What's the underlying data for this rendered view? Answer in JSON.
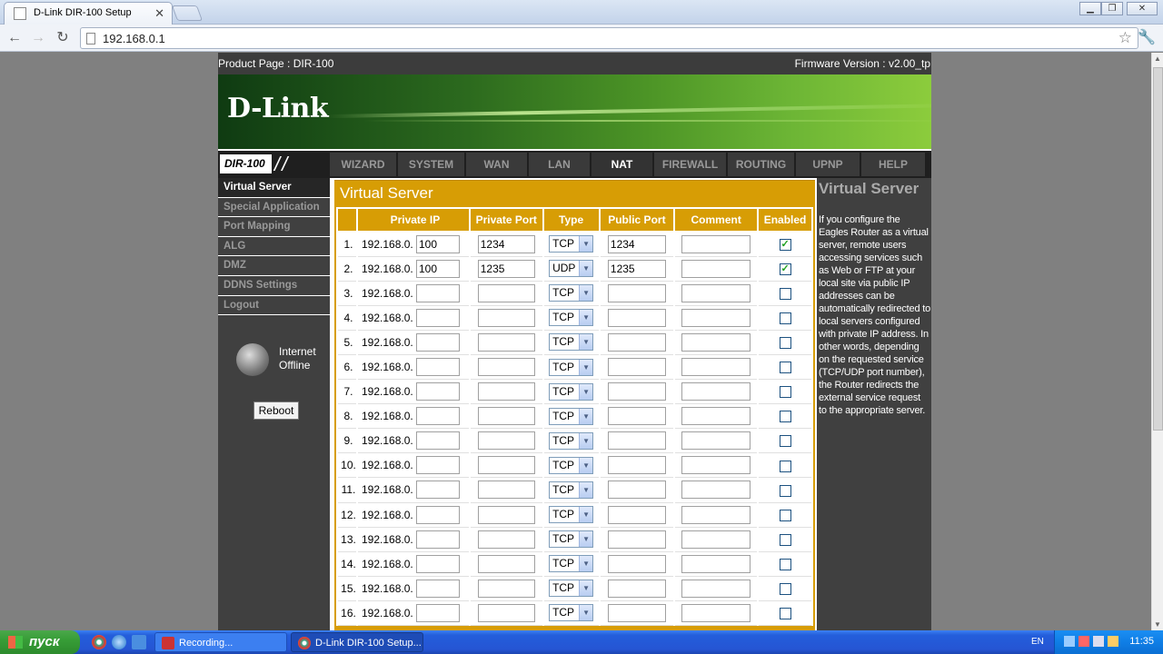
{
  "browser": {
    "tab_title": "D-Link DIR-100 Setup",
    "url": "192.168.0.1"
  },
  "router": {
    "product_page": "Product Page : DIR-100",
    "firmware": "Firmware Version : v2.00_tp",
    "logo": "D-Link",
    "model": "DIR-100",
    "nav_tabs": [
      "WIZARD",
      "SYSTEM",
      "WAN",
      "LAN",
      "NAT",
      "FIREWALL",
      "ROUTING",
      "UPNP",
      "HELP"
    ],
    "active_tab": "NAT",
    "side_menu": [
      "Virtual Server",
      "Special Application",
      "Port Mapping",
      "ALG",
      "DMZ",
      "DDNS Settings",
      "Logout"
    ],
    "active_menu": "Virtual Server",
    "internet_status": [
      "Internet",
      "Offline"
    ],
    "reboot_label": "Reboot"
  },
  "virtual_server": {
    "title": "Virtual Server",
    "headers": [
      "Private IP",
      "Private Port",
      "Type",
      "Public Port",
      "Comment",
      "Enabled"
    ],
    "ip_prefix": "192.168.0.",
    "rows": [
      {
        "num": "1.",
        "ip": "100",
        "private_port": "1234",
        "type": "TCP",
        "public_port": "1234",
        "comment": "",
        "enabled": true
      },
      {
        "num": "2.",
        "ip": "100",
        "private_port": "1235",
        "type": "UDP",
        "public_port": "1235",
        "comment": "",
        "enabled": true
      },
      {
        "num": "3.",
        "ip": "",
        "private_port": "",
        "type": "TCP",
        "public_port": "",
        "comment": "",
        "enabled": false
      },
      {
        "num": "4.",
        "ip": "",
        "private_port": "",
        "type": "TCP",
        "public_port": "",
        "comment": "",
        "enabled": false
      },
      {
        "num": "5.",
        "ip": "",
        "private_port": "",
        "type": "TCP",
        "public_port": "",
        "comment": "",
        "enabled": false
      },
      {
        "num": "6.",
        "ip": "",
        "private_port": "",
        "type": "TCP",
        "public_port": "",
        "comment": "",
        "enabled": false
      },
      {
        "num": "7.",
        "ip": "",
        "private_port": "",
        "type": "TCP",
        "public_port": "",
        "comment": "",
        "enabled": false
      },
      {
        "num": "8.",
        "ip": "",
        "private_port": "",
        "type": "TCP",
        "public_port": "",
        "comment": "",
        "enabled": false
      },
      {
        "num": "9.",
        "ip": "",
        "private_port": "",
        "type": "TCP",
        "public_port": "",
        "comment": "",
        "enabled": false
      },
      {
        "num": "10.",
        "ip": "",
        "private_port": "",
        "type": "TCP",
        "public_port": "",
        "comment": "",
        "enabled": false
      },
      {
        "num": "11.",
        "ip": "",
        "private_port": "",
        "type": "TCP",
        "public_port": "",
        "comment": "",
        "enabled": false
      },
      {
        "num": "12.",
        "ip": "",
        "private_port": "",
        "type": "TCP",
        "public_port": "",
        "comment": "",
        "enabled": false
      },
      {
        "num": "13.",
        "ip": "",
        "private_port": "",
        "type": "TCP",
        "public_port": "",
        "comment": "",
        "enabled": false
      },
      {
        "num": "14.",
        "ip": "",
        "private_port": "",
        "type": "TCP",
        "public_port": "",
        "comment": "",
        "enabled": false
      },
      {
        "num": "15.",
        "ip": "",
        "private_port": "",
        "type": "TCP",
        "public_port": "",
        "comment": "",
        "enabled": false
      },
      {
        "num": "16.",
        "ip": "",
        "private_port": "",
        "type": "TCP",
        "public_port": "",
        "comment": "",
        "enabled": false
      }
    ]
  },
  "help": {
    "title": "Virtual Server",
    "text": "If you configure the Eagles Router as a virtual server, remote users accessing services such as Web or FTP at your local site via public IP addresses can be automatically redirected to local servers configured with private IP address. In other words, depending on the requested service (TCP/UDP port number), the Router redirects the external service request to the appropriate server."
  },
  "taskbar": {
    "start_label": "пуск",
    "tasks": [
      "Recording...",
      "D-Link DIR-100 Setup..."
    ],
    "language": "EN",
    "clock": "11:35"
  }
}
